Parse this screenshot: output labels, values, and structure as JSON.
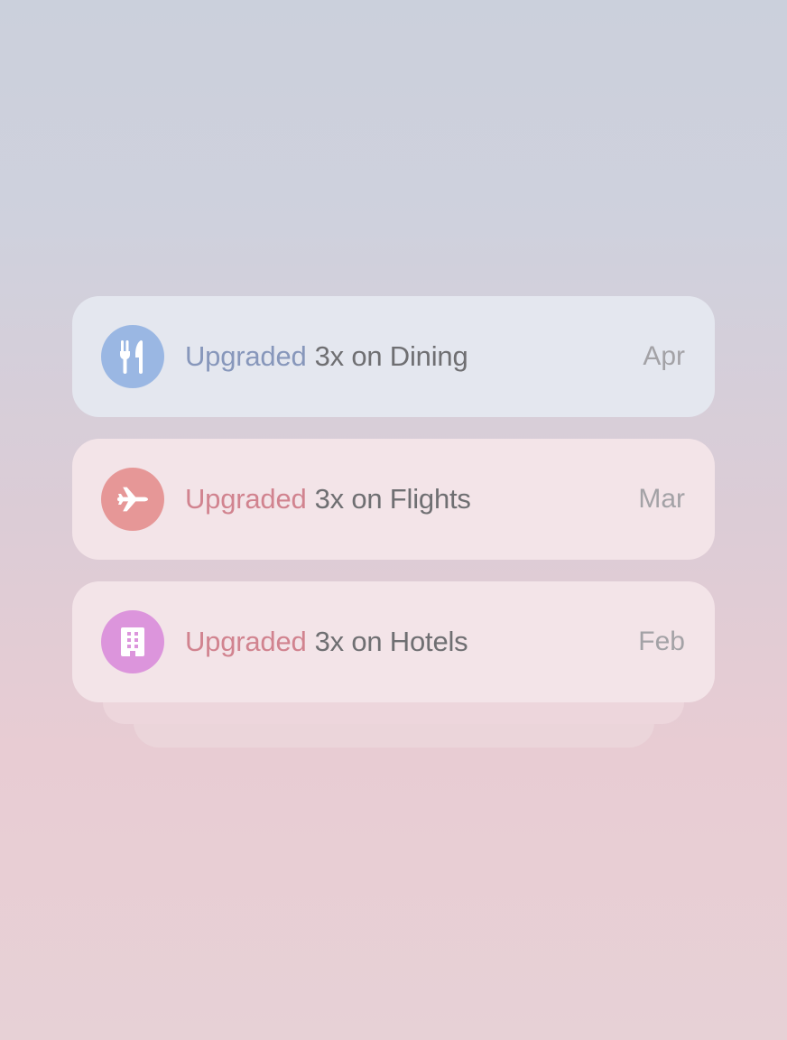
{
  "notifications": [
    {
      "icon": "fork-knife-icon",
      "icon_color": "#9ab7e3",
      "prefix": "Upgraded",
      "prefix_color": "#8797bb",
      "text": "3x on Dining",
      "date": "Apr",
      "card_color": "#e4e7ef"
    },
    {
      "icon": "airplane-icon",
      "icon_color": "#e69797",
      "prefix": "Upgraded",
      "prefix_color": "#d1838f",
      "text": "3x on Flights",
      "date": "Mar",
      "card_color": "#f3e4e8"
    },
    {
      "icon": "building-icon",
      "icon_color": "#dc95dc",
      "prefix": "Upgraded",
      "prefix_color": "#d1838f",
      "text": "3x on Hotels",
      "date": "Feb",
      "card_color": "#f3e4e8"
    }
  ]
}
